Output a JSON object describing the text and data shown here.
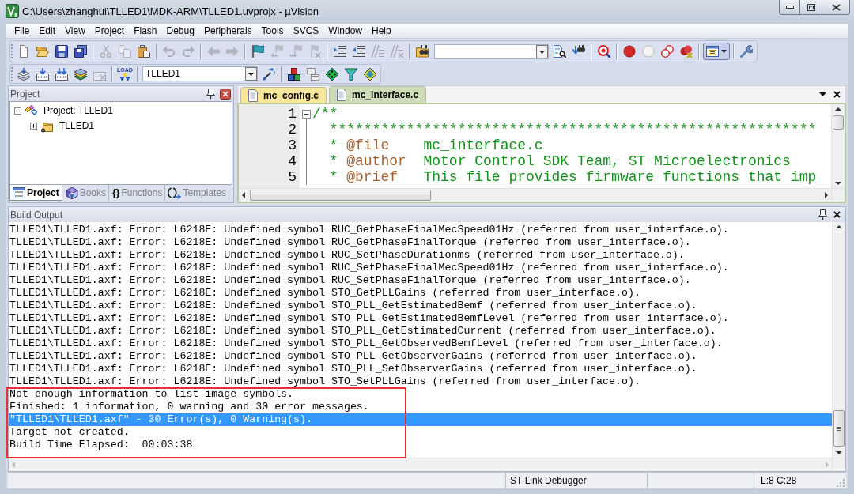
{
  "window": {
    "title": "C:\\Users\\zhanghui\\TLLED1\\MDK-ARM\\TLLED1.uvprojx - µVision"
  },
  "menu": [
    "File",
    "Edit",
    "View",
    "Project",
    "Flash",
    "Debug",
    "Peripherals",
    "Tools",
    "SVCS",
    "Window",
    "Help"
  ],
  "toolbars": [
    {
      "groups": [
        [
          {
            "kind": "new",
            "disabled": false,
            "pressed": false
          },
          {
            "kind": "open",
            "disabled": false,
            "pressed": false
          },
          {
            "kind": "save",
            "disabled": false,
            "pressed": false
          },
          {
            "kind": "save-all",
            "disabled": false,
            "pressed": false
          }
        ],
        [
          {
            "kind": "cut",
            "disabled": true,
            "pressed": false
          },
          {
            "kind": "copy",
            "disabled": true,
            "pressed": false
          },
          {
            "kind": "paste",
            "disabled": false,
            "pressed": false
          }
        ],
        [
          {
            "kind": "undo",
            "disabled": true,
            "pressed": false
          },
          {
            "kind": "redo",
            "disabled": true,
            "pressed": false
          }
        ],
        [
          {
            "kind": "back",
            "disabled": true,
            "pressed": false
          },
          {
            "kind": "forward",
            "disabled": true,
            "pressed": false
          }
        ],
        [
          {
            "kind": "bookmark",
            "disabled": false,
            "pressed": false
          },
          {
            "kind": "bookmark-prev",
            "disabled": true,
            "pressed": false
          },
          {
            "kind": "bookmark-next",
            "disabled": true,
            "pressed": false
          },
          {
            "kind": "bookmark-clear",
            "disabled": true,
            "pressed": false
          }
        ],
        [
          {
            "kind": "indent",
            "disabled": false,
            "pressed": false
          },
          {
            "kind": "outdent",
            "disabled": false,
            "pressed": false
          },
          {
            "kind": "comment",
            "disabled": true,
            "pressed": false
          },
          {
            "kind": "uncomment",
            "disabled": true,
            "pressed": false
          }
        ],
        [
          {
            "kind": "find-in-files",
            "disabled": false,
            "pressed": false
          },
          {
            "kind": "find-combo"
          },
          {
            "kind": "find",
            "disabled": false,
            "pressed": false
          },
          {
            "kind": "incremental-find",
            "disabled": false,
            "pressed": false
          }
        ],
        [
          {
            "kind": "debug",
            "disabled": false,
            "pressed": false
          }
        ],
        [
          {
            "kind": "breakpoint",
            "disabled": false,
            "pressed": false
          },
          {
            "kind": "breakpoint-enable",
            "disabled": false,
            "pressed": false
          },
          {
            "kind": "breakpoint-disable-all",
            "disabled": false,
            "pressed": false
          },
          {
            "kind": "breakpoint-kill-all",
            "disabled": false,
            "pressed": false
          }
        ],
        [
          {
            "kind": "windows",
            "disabled": false,
            "pressed": true
          }
        ],
        [
          {
            "kind": "configure",
            "disabled": false,
            "pressed": false
          }
        ]
      ]
    },
    {
      "groups": [
        [
          {
            "kind": "translate",
            "disabled": false,
            "pressed": false
          },
          {
            "kind": "build",
            "disabled": false,
            "pressed": false
          },
          {
            "kind": "rebuild",
            "disabled": false,
            "pressed": false
          },
          {
            "kind": "batch-build",
            "disabled": false,
            "pressed": false
          },
          {
            "kind": "stop-build",
            "disabled": true,
            "pressed": false
          }
        ],
        [
          {
            "kind": "download",
            "text": "LOAD",
            "disabled": false,
            "pressed": false
          }
        ],
        [
          {
            "kind": "target-combo",
            "value": "TLLED1"
          },
          {
            "kind": "target-options",
            "disabled": false,
            "pressed": false
          }
        ],
        [
          {
            "kind": "manage-components",
            "disabled": false,
            "pressed": false
          },
          {
            "kind": "multi-project",
            "disabled": false,
            "pressed": false
          },
          {
            "kind": "rte",
            "disabled": false,
            "pressed": false
          },
          {
            "kind": "packs",
            "disabled": false,
            "pressed": false
          },
          {
            "kind": "pack-installer",
            "disabled": false,
            "pressed": false
          }
        ]
      ]
    }
  ],
  "project_panel": {
    "title": "Project",
    "tree": [
      {
        "label": "Project: TLLED1",
        "kind": "project",
        "expanded": true,
        "children": [
          {
            "label": "TLLED1",
            "kind": "target",
            "expanded": false
          }
        ]
      }
    ],
    "tabs": [
      {
        "label": "Project",
        "kind": "project",
        "selected": true
      },
      {
        "label": "Books",
        "kind": "books",
        "selected": false
      },
      {
        "label": "Functions",
        "kind": "functions",
        "glyph": "{}",
        "selected": false
      },
      {
        "label": "Templates",
        "kind": "templates",
        "selected": false
      }
    ]
  },
  "editor": {
    "tabs": [
      {
        "label": "mc_config.c",
        "color": "#fbe79c",
        "selected": false
      },
      {
        "label": "mc_interface.c",
        "color": "#cfdcb8",
        "selected": true
      }
    ],
    "lines": [
      {
        "number": "1",
        "fold_start": true,
        "segments": [
          {
            "kind": "comment",
            "text": "/**"
          }
        ]
      },
      {
        "number": "2",
        "fold_start": false,
        "segments": [
          {
            "kind": "comment",
            "text": "  *********************************************************"
          }
        ]
      },
      {
        "number": "3",
        "fold_start": false,
        "segments": [
          {
            "kind": "comment",
            "text": "  * "
          },
          {
            "kind": "tag",
            "text": "@file"
          },
          {
            "kind": "comment",
            "text": "    mc_interface.c"
          }
        ]
      },
      {
        "number": "4",
        "fold_start": false,
        "segments": [
          {
            "kind": "comment",
            "text": "  * "
          },
          {
            "kind": "tag",
            "text": "@author"
          },
          {
            "kind": "comment",
            "text": "  Motor Control SDK Team, ST Microelectronics"
          }
        ]
      },
      {
        "number": "5",
        "fold_start": false,
        "segments": [
          {
            "kind": "comment",
            "text": "  * "
          },
          {
            "kind": "tag",
            "text": "@brief"
          },
          {
            "kind": "comment",
            "text": "   This file provides firmware functions that imp"
          }
        ]
      }
    ]
  },
  "build_output": {
    "title": "Build Output",
    "lines": [
      {
        "text": "TLLED1\\TLLED1.axf: Error: L6218E: Undefined symbol RUC_GetPhaseFinalMecSpeed01Hz (referred from user_interface.o).",
        "selected": false,
        "boxed": false
      },
      {
        "text": "TLLED1\\TLLED1.axf: Error: L6218E: Undefined symbol RUC_GetPhaseFinalTorque (referred from user_interface.o).",
        "selected": false,
        "boxed": false
      },
      {
        "text": "TLLED1\\TLLED1.axf: Error: L6218E: Undefined symbol RUC_SetPhaseDurationms (referred from user_interface.o).",
        "selected": false,
        "boxed": false
      },
      {
        "text": "TLLED1\\TLLED1.axf: Error: L6218E: Undefined symbol RUC_SetPhaseFinalMecSpeed01Hz (referred from user_interface.o).",
        "selected": false,
        "boxed": false
      },
      {
        "text": "TLLED1\\TLLED1.axf: Error: L6218E: Undefined symbol RUC_SetPhaseFinalTorque (referred from user_interface.o).",
        "selected": false,
        "boxed": false
      },
      {
        "text": "TLLED1\\TLLED1.axf: Error: L6218E: Undefined symbol STO_GetPLLGains (referred from user_interface.o).",
        "selected": false,
        "boxed": false
      },
      {
        "text": "TLLED1\\TLLED1.axf: Error: L6218E: Undefined symbol STO_PLL_GetEstimatedBemf (referred from user_interface.o).",
        "selected": false,
        "boxed": false
      },
      {
        "text": "TLLED1\\TLLED1.axf: Error: L6218E: Undefined symbol STO_PLL_GetEstimatedBemfLevel (referred from user_interface.o).",
        "selected": false,
        "boxed": false
      },
      {
        "text": "TLLED1\\TLLED1.axf: Error: L6218E: Undefined symbol STO_PLL_GetEstimatedCurrent (referred from user_interface.o).",
        "selected": false,
        "boxed": false
      },
      {
        "text": "TLLED1\\TLLED1.axf: Error: L6218E: Undefined symbol STO_PLL_GetObservedBemfLevel (referred from user_interface.o).",
        "selected": false,
        "boxed": false
      },
      {
        "text": "TLLED1\\TLLED1.axf: Error: L6218E: Undefined symbol STO_PLL_GetObserverGains (referred from user_interface.o).",
        "selected": false,
        "boxed": false
      },
      {
        "text": "TLLED1\\TLLED1.axf: Error: L6218E: Undefined symbol STO_PLL_SetObserverGains (referred from user_interface.o).",
        "selected": false,
        "boxed": false
      },
      {
        "text": "TLLED1\\TLLED1.axf: Error: L6218E: Undefined symbol STO_SetPLLGains (referred from user_interface.o).",
        "selected": false,
        "boxed": false
      },
      {
        "text": "Not enough information to list image symbols.",
        "selected": false,
        "boxed": true
      },
      {
        "text": "Finished: 1 information, 0 warning and 30 error messages.",
        "selected": false,
        "boxed": true
      },
      {
        "text": "\"TLLED1\\TLLED1.axf\" - 30 Error(s), 0 Warning(s).",
        "selected": true,
        "boxed": true
      },
      {
        "text": "Target not created.",
        "selected": false,
        "boxed": true
      },
      {
        "text": "Build Time Elapsed:  00:03:38",
        "selected": false,
        "boxed": true
      }
    ]
  },
  "status_bar": {
    "debugger": "ST-Link Debugger",
    "cursor": "L:8 C:28"
  }
}
